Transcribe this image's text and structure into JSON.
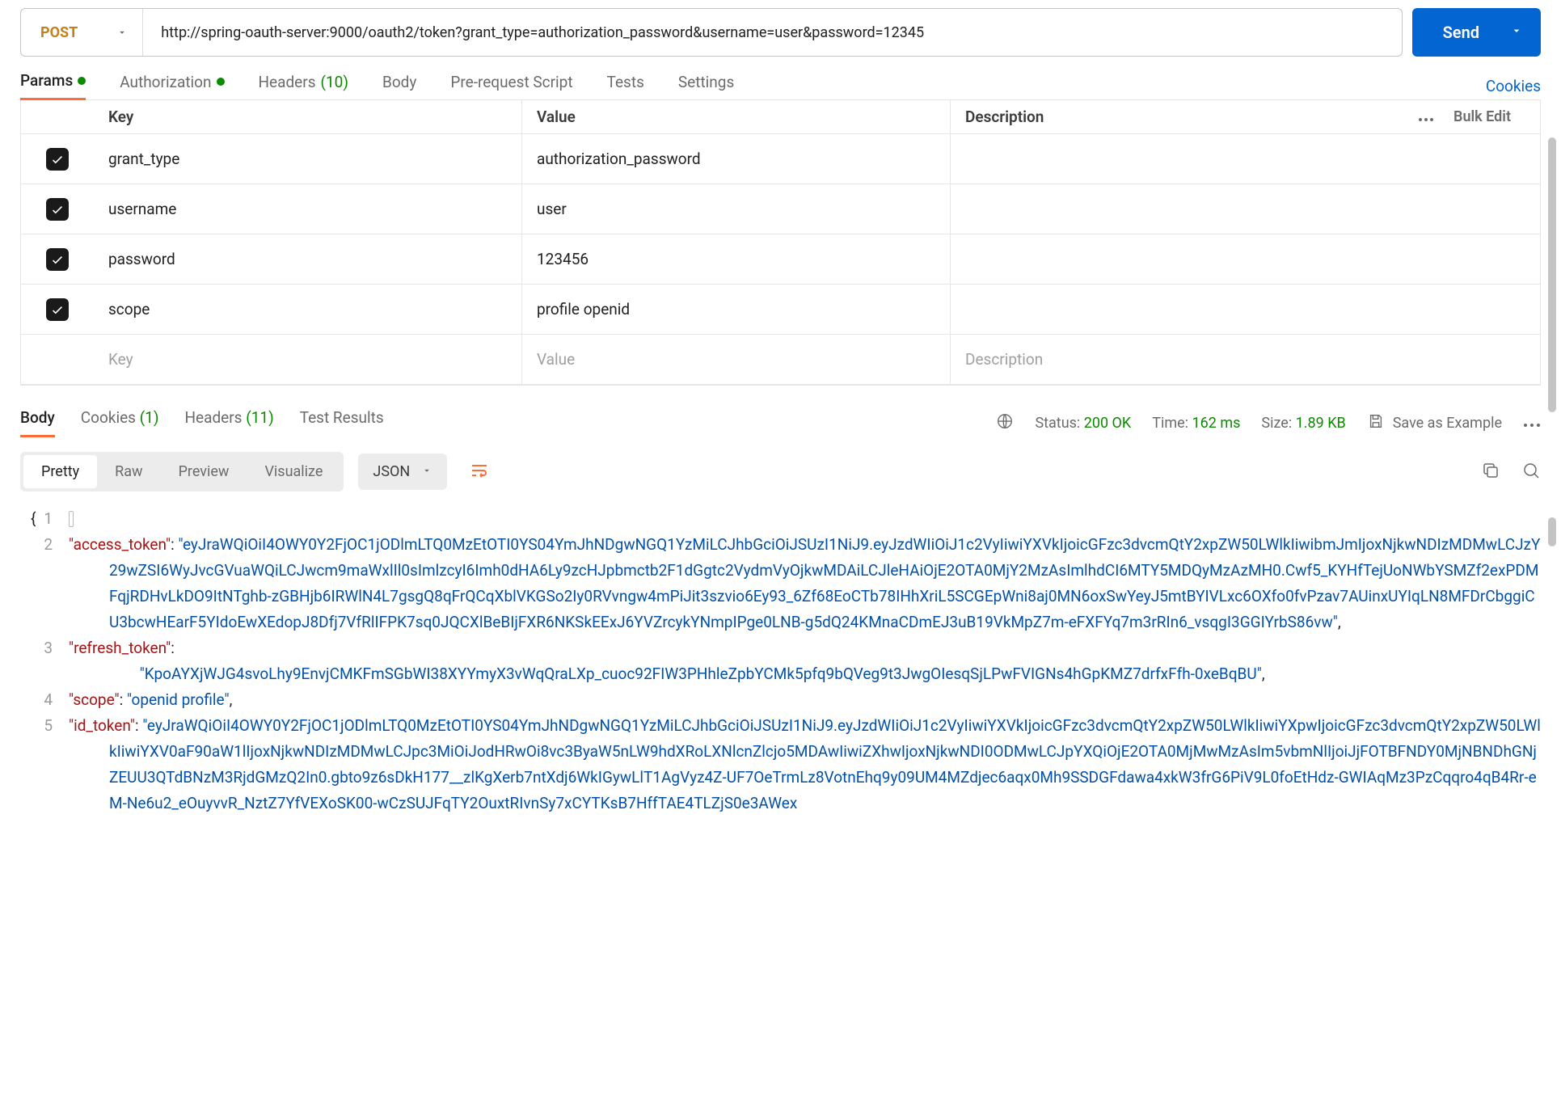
{
  "request": {
    "method": "POST",
    "url": "http://spring-oauth-server:9000/oauth2/token?grant_type=authorization_password&username=user&password=12345",
    "send_label": "Send"
  },
  "tabs": {
    "params": "Params",
    "authorization": "Authorization",
    "headers": "Headers",
    "headers_count": "(10)",
    "body": "Body",
    "prerequest": "Pre-request Script",
    "tests": "Tests",
    "settings": "Settings",
    "cookies": "Cookies"
  },
  "params_table": {
    "header_key": "Key",
    "header_value": "Value",
    "header_desc": "Description",
    "bulk_edit": "Bulk Edit",
    "rows": [
      {
        "key": "grant_type",
        "value": "authorization_password",
        "desc": ""
      },
      {
        "key": "username",
        "value": "user",
        "desc": ""
      },
      {
        "key": "password",
        "value": "123456",
        "desc": ""
      },
      {
        "key": "scope",
        "value": "profile openid",
        "desc": ""
      }
    ],
    "placeholder_key": "Key",
    "placeholder_value": "Value",
    "placeholder_desc": "Description"
  },
  "response_tabs": {
    "body": "Body",
    "cookies": "Cookies",
    "cookies_count": "(1)",
    "headers": "Headers",
    "headers_count": "(11)",
    "test_results": "Test Results"
  },
  "response_meta": {
    "status_label": "Status:",
    "status_value": "200 OK",
    "time_label": "Time:",
    "time_value": "162 ms",
    "size_label": "Size:",
    "size_value": "1.89 KB",
    "save_example": "Save as Example"
  },
  "view_modes": {
    "pretty": "Pretty",
    "raw": "Raw",
    "preview": "Preview",
    "visualize": "Visualize",
    "format": "JSON"
  },
  "json_response": {
    "line1_brace": "{",
    "access_token_key": "\"access_token\"",
    "access_token_value": "\"eyJraWQiOiI4OWY0Y2FjOC1jODlmLTQ0MzEtOTI0YS04YmJhNDgwNGQ1YzMiLCJhbGciOiJSUzI1NiJ9.eyJzdWIiOiJ1c2VyIiwiYXVkIjoicGFzc3dvcmQtY2xpZW50LWlkIiwibmJmIjoxNjkwNDIzMDMwLCJzY29wZSI6WyJvcGVuaWQiLCJwcm9maWxlIl0sImlzcyI6Imh0dHA6Ly9zcHJpbmctb2F1dGgtc2VydmVyOjkwMDAiLCJleHAiOjE2OTA0MjY2MzAsImlhdCI6MTY5MDQyMzAzMH0.Cwf5_KYHfTejUoNWbYSMZf2exPDMFqjRDHvLkDO9ItNTghb-zGBHjb6IRWlN4L7gsgQ8qFrQCqXblVKGSo2Iy0RVvngw4mPiJit3szvio6Ey93_6Zf68EoCTb78IHhXriL5SCGEpWni8aj0MN6oxSwYeyJ5mtBYIVLxc6OXfo0fvPzav7AUinxUYIqLN8MFDrCbggiCU3bcwHEarF5YIdoEwXEdopJ8Dfj7VfRlIFPK7sq0JQCXlBeBIjFXR6NKSkEExJ6YVZrcykYNmpIPge0LNB-g5dQ24KMnaCDmEJ3uB19VkMpZ7m-eFXFYq7m3rRIn6_vsqgI3GGIYrbS86vw\"",
    "refresh_token_key": "\"refresh_token\"",
    "refresh_token_value": "\"KpoAYXjWJG4svoLhy9EnvjCMKFmSGbWI38XYYmyX3vWqQraLXp_cuoc92FIW3PHhleZpbYCMk5pfq9bQVeg9t3JwgOIesqSjLPwFVIGNs4hGpKMZ7drfxFfh-0xeBqBU\"",
    "scope_key": "\"scope\"",
    "scope_value": "\"openid profile\"",
    "id_token_key": "\"id_token\"",
    "id_token_value": "\"eyJraWQiOiI4OWY0Y2FjOC1jODlmLTQ0MzEtOTI0YS04YmJhNDgwNGQ1YzMiLCJhbGciOiJSUzI1NiJ9.eyJzdWIiOiJ1c2VyIiwiYXVkIjoicGFzc3dvcmQtY2xpZW50LWlkIiwiYXpwIjoicGFzc3dvcmQtY2xpZW50LWlkIiwiYXV0aF90aW1lIjoxNjkwNDIzMDMwLCJpc3MiOiJodHRwOi8vc3ByaW5nLW9hdXRoLXNlcnZlcjo5MDAwIiwiZXhwIjoxNjkwNDI0ODMwLCJpYXQiOjE2OTA0MjMwMzAsIm5vbmNlIjoiJjFOTBFNDY0MjNBNDhGNjZEUU3QTdBNzM3RjdGMzQ2In0.gbto9z6sDkH177__zlKgXerb7ntXdj6WkIGywLlT1AgVyz4Z-UF7OeTrmLz8VotnEhq9y09UM4MZdjec6aqx0Mh9SSDGFdawa4xkW3frG6PiV9L0foEtHdz-GWIAqMz3PzCqqro4qB4Rr-eM-Ne6u2_eOuyvvR_NztZ7YfVEXoSK00-wCzSUJFqTY2OuxtRIvnSy7xCYTKsB7HffTAE4TLZjS0e3AWex"
  }
}
